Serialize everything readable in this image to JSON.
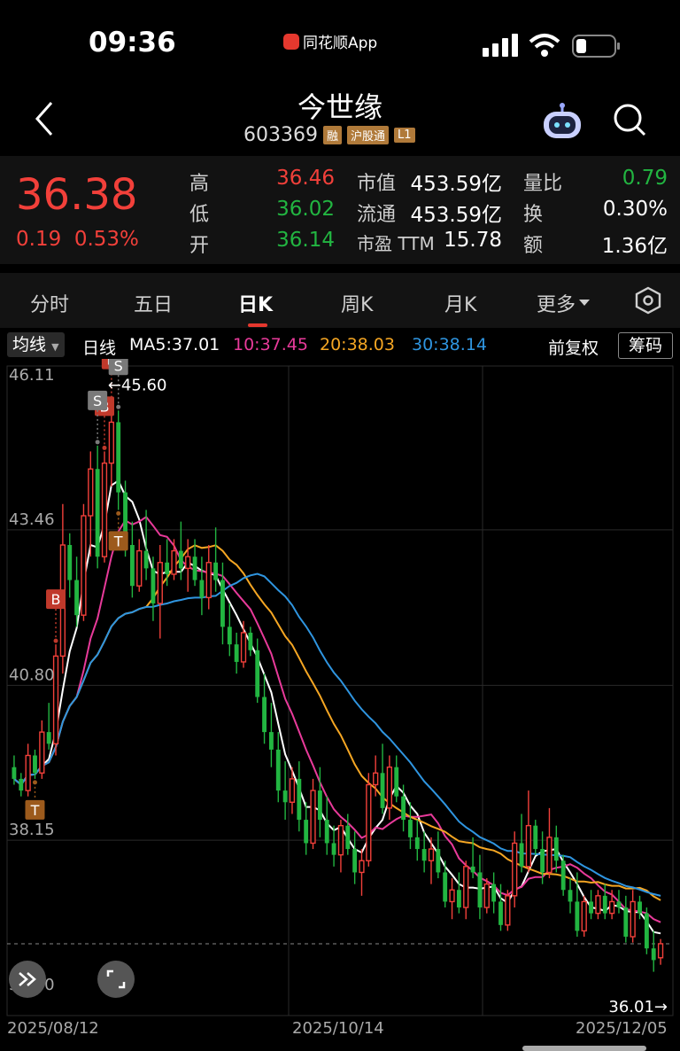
{
  "status": {
    "time": "09:36",
    "app": "同花顺App"
  },
  "header": {
    "title": "今世缘",
    "code": "603369",
    "badges": [
      "融",
      "沪股通",
      "L1"
    ]
  },
  "quote": {
    "price": "36.38",
    "change": "0.19",
    "change_pct": "0.53%",
    "stats": [
      {
        "label": "高",
        "value": "36.46",
        "color": "red"
      },
      {
        "label": "低",
        "value": "36.02",
        "color": "green"
      },
      {
        "label": "开",
        "value": "36.14",
        "color": "green"
      }
    ],
    "cap": [
      {
        "label": "市值",
        "value": "453.59亿"
      },
      {
        "label": "流通",
        "value": "453.59亿"
      },
      {
        "label": "市盈 TTM",
        "value": "15.78"
      }
    ],
    "ratio": [
      {
        "label": "量比",
        "value": "0.79",
        "color": "green"
      },
      {
        "label": "换",
        "value": "0.30%",
        "color": "white"
      },
      {
        "label": "额",
        "value": "1.36亿",
        "color": "white"
      }
    ]
  },
  "tabs": [
    "分时",
    "五日",
    "日K",
    "周K",
    "月K",
    "更多"
  ],
  "active_tab": "日K",
  "indicator": {
    "ma_button": "均线",
    "period": "日线",
    "ma5": "MA5:37.01",
    "ma10": "10:37.45",
    "ma20": "20:38.03",
    "ma30": "30:38.14",
    "adjust": "前复权",
    "chip": "筹码"
  },
  "colors": {
    "up": "#f2403a",
    "down": "#22b541",
    "ma5": "#ffffff",
    "ma10": "#e83a9a",
    "ma20": "#f5a623",
    "ma30": "#2f95e0"
  },
  "chart_data": {
    "type": "candlestick",
    "y_ticks": [
      "46.11",
      "43.46",
      "40.80",
      "38.15",
      "35.50"
    ],
    "ylim": [
      35.5,
      46.11
    ],
    "x_labels": [
      "2025/08/12",
      "2025/10/14",
      "2025/12/05"
    ],
    "high_marker": "←45.60",
    "last_marker": "36.01→",
    "candles": [
      [
        39.4,
        39.6,
        39.1,
        39.2
      ],
      [
        39.2,
        39.3,
        38.9,
        39.0
      ],
      [
        39.0,
        39.8,
        38.9,
        39.6
      ],
      [
        39.6,
        39.7,
        39.2,
        39.3
      ],
      [
        39.3,
        40.2,
        39.2,
        40.0
      ],
      [
        40.0,
        40.5,
        39.7,
        39.8
      ],
      [
        39.8,
        41.5,
        39.6,
        41.3
      ],
      [
        41.3,
        43.9,
        41.0,
        43.2
      ],
      [
        43.2,
        43.4,
        42.3,
        42.6
      ],
      [
        42.6,
        43.0,
        41.8,
        42.0
      ],
      [
        42.0,
        43.9,
        41.9,
        43.7
      ],
      [
        43.7,
        44.8,
        43.0,
        44.5
      ],
      [
        44.5,
        44.9,
        42.8,
        43.0
      ],
      [
        43.0,
        44.8,
        42.9,
        44.6
      ],
      [
        44.6,
        45.6,
        44.2,
        45.3
      ],
      [
        45.3,
        45.5,
        43.8,
        44.1
      ],
      [
        44.1,
        44.3,
        43.0,
        43.2
      ],
      [
        43.2,
        43.6,
        42.3,
        42.5
      ],
      [
        42.5,
        43.3,
        42.4,
        43.1
      ],
      [
        43.1,
        43.8,
        42.6,
        42.8
      ],
      [
        42.8,
        43.0,
        41.9,
        42.2
      ],
      [
        42.2,
        43.2,
        41.6,
        42.9
      ],
      [
        42.9,
        43.3,
        42.5,
        42.7
      ],
      [
        42.7,
        43.3,
        42.6,
        43.1
      ],
      [
        43.1,
        43.6,
        42.6,
        42.8
      ],
      [
        42.8,
        43.3,
        42.4,
        43.0
      ],
      [
        43.0,
        43.3,
        42.5,
        42.6
      ],
      [
        42.6,
        43.0,
        42.0,
        42.3
      ],
      [
        42.3,
        43.2,
        42.1,
        42.9
      ],
      [
        42.9,
        43.5,
        42.4,
        42.6
      ],
      [
        42.6,
        42.9,
        41.5,
        41.8
      ],
      [
        41.8,
        42.2,
        41.3,
        41.5
      ],
      [
        41.5,
        41.7,
        41.0,
        41.2
      ],
      [
        41.2,
        41.9,
        41.1,
        41.7
      ],
      [
        41.7,
        41.8,
        41.3,
        41.4
      ],
      [
        41.4,
        41.6,
        40.5,
        40.6
      ],
      [
        40.6,
        41.0,
        39.8,
        40.0
      ],
      [
        40.0,
        40.5,
        39.4,
        39.7
      ],
      [
        39.7,
        40.0,
        38.8,
        39.0
      ],
      [
        39.0,
        39.5,
        38.5,
        38.8
      ],
      [
        38.8,
        39.4,
        38.6,
        39.2
      ],
      [
        39.2,
        39.5,
        38.3,
        38.5
      ],
      [
        38.5,
        38.8,
        37.9,
        38.1
      ],
      [
        38.1,
        39.2,
        38.0,
        39.0
      ],
      [
        39.0,
        39.4,
        38.2,
        38.5
      ],
      [
        38.5,
        38.9,
        37.9,
        38.1
      ],
      [
        38.1,
        38.4,
        37.7,
        37.9
      ],
      [
        37.9,
        38.5,
        37.6,
        38.4
      ],
      [
        38.4,
        38.6,
        37.9,
        38.0
      ],
      [
        38.0,
        38.3,
        37.4,
        37.6
      ],
      [
        37.6,
        38.0,
        37.2,
        37.8
      ],
      [
        37.8,
        39.3,
        37.7,
        39.1
      ],
      [
        39.1,
        39.6,
        38.9,
        39.3
      ],
      [
        39.3,
        39.8,
        38.6,
        38.7
      ],
      [
        38.7,
        39.6,
        38.5,
        39.4
      ],
      [
        39.4,
        39.6,
        38.8,
        38.9
      ],
      [
        38.9,
        39.1,
        38.3,
        38.5
      ],
      [
        38.5,
        38.8,
        38.0,
        38.2
      ],
      [
        38.2,
        38.5,
        37.8,
        38.0
      ],
      [
        38.0,
        38.3,
        37.6,
        37.8
      ],
      [
        37.8,
        38.2,
        37.4,
        38.0
      ],
      [
        38.0,
        38.3,
        37.5,
        37.6
      ],
      [
        37.6,
        37.8,
        37.0,
        37.1
      ],
      [
        37.1,
        37.5,
        36.8,
        37.3
      ],
      [
        37.3,
        37.6,
        36.9,
        37.0
      ],
      [
        37.0,
        37.8,
        36.8,
        37.7
      ],
      [
        37.7,
        38.2,
        37.5,
        37.6
      ],
      [
        37.6,
        37.9,
        36.8,
        37.0
      ],
      [
        37.0,
        37.5,
        36.9,
        37.4
      ],
      [
        37.4,
        37.6,
        36.9,
        37.1
      ],
      [
        37.1,
        37.4,
        36.6,
        36.7
      ],
      [
        36.7,
        37.3,
        36.6,
        37.2
      ],
      [
        37.2,
        38.3,
        37.0,
        38.1
      ],
      [
        38.1,
        38.6,
        37.6,
        37.7
      ],
      [
        37.7,
        39.0,
        37.6,
        38.4
      ],
      [
        38.4,
        38.5,
        37.9,
        38.0
      ],
      [
        38.0,
        38.3,
        37.4,
        37.6
      ],
      [
        37.6,
        38.7,
        37.5,
        38.2
      ],
      [
        38.2,
        38.4,
        37.6,
        37.8
      ],
      [
        37.8,
        37.9,
        37.2,
        37.3
      ],
      [
        37.3,
        37.5,
        36.9,
        37.1
      ],
      [
        37.1,
        37.6,
        36.5,
        36.6
      ],
      [
        36.6,
        37.2,
        36.5,
        37.1
      ],
      [
        37.1,
        37.3,
        36.8,
        36.9
      ],
      [
        36.9,
        37.3,
        36.8,
        37.2
      ],
      [
        37.2,
        37.4,
        36.8,
        36.9
      ],
      [
        36.9,
        37.3,
        36.8,
        37.1
      ],
      [
        37.1,
        37.3,
        36.9,
        37.0
      ],
      [
        37.0,
        37.2,
        36.4,
        36.5
      ],
      [
        36.5,
        37.3,
        36.4,
        37.1
      ],
      [
        37.1,
        37.2,
        36.8,
        36.9
      ],
      [
        36.9,
        37.0,
        36.2,
        36.3
      ],
      [
        36.3,
        36.6,
        35.9,
        36.1
      ],
      [
        36.14,
        36.46,
        36.02,
        36.38
      ]
    ],
    "markers": [
      {
        "label": "B",
        "type": "B",
        "candle": 6
      },
      {
        "label": "B",
        "type": "B",
        "candle": 13
      },
      {
        "label": "B",
        "type": "B",
        "candle": 14
      },
      {
        "label": "S",
        "type": "S",
        "candle": 15
      },
      {
        "label": "S",
        "type": "S",
        "candle": 12
      },
      {
        "label": "T",
        "type": "T",
        "candle": 3
      },
      {
        "label": "T",
        "type": "T",
        "candle": 15
      }
    ]
  }
}
